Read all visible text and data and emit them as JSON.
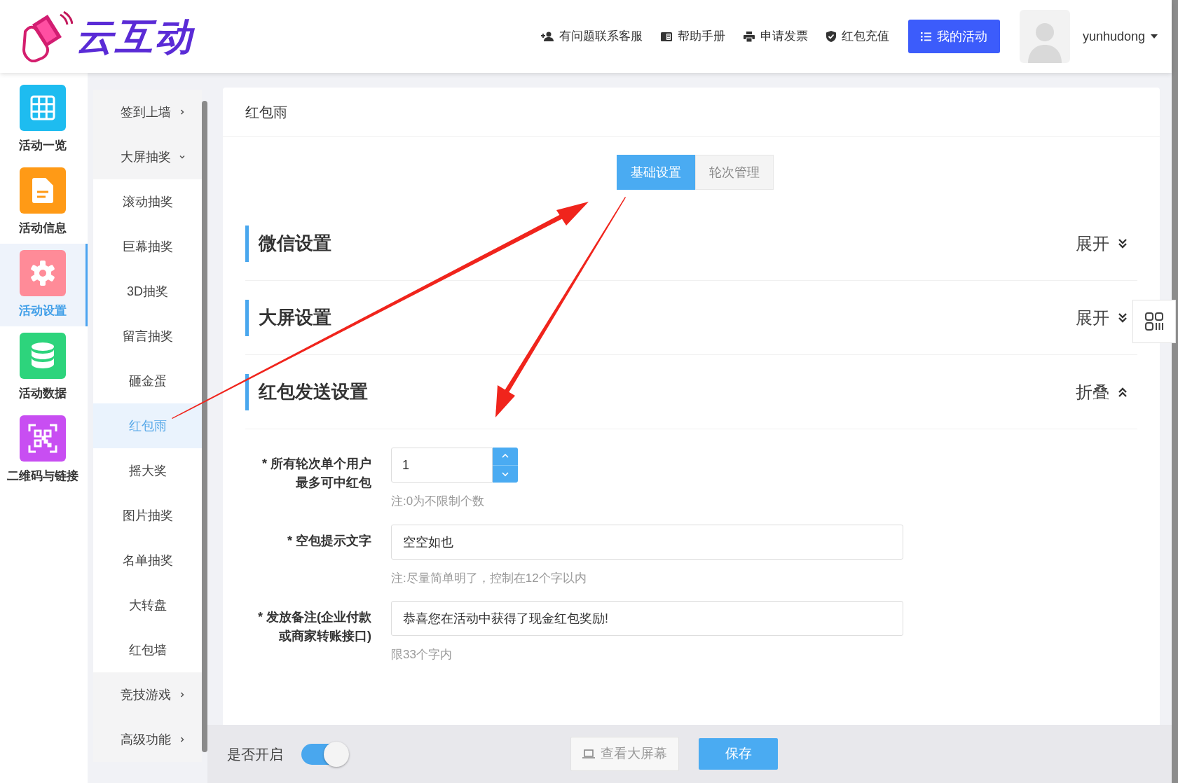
{
  "header": {
    "logo_text": "云互动",
    "links": [
      {
        "label": "有问题联系客服",
        "kind": "contact"
      },
      {
        "label": "帮助手册",
        "kind": "manual"
      },
      {
        "label": "申请发票",
        "kind": "invoice"
      },
      {
        "label": "红包充值",
        "kind": "recharge"
      }
    ],
    "primary_button": "我的活动",
    "username": "yunhudong"
  },
  "sidebar": {
    "items": [
      {
        "label": "活动一览",
        "kind": "overview",
        "color": "#1ebcf0",
        "selected": false
      },
      {
        "label": "活动信息",
        "kind": "info",
        "color": "#ff9a16",
        "selected": false
      },
      {
        "label": "活动设置",
        "kind": "settings",
        "color": "#ff8b98",
        "selected": true
      },
      {
        "label": "活动数据",
        "kind": "data",
        "color": "#2dd47c",
        "selected": false
      },
      {
        "label": "二维码与链接",
        "kind": "links",
        "color": "#c84ef2",
        "selected": false
      }
    ]
  },
  "submenu": {
    "items": [
      {
        "label": "签到上墙",
        "expanded": false
      },
      {
        "label": "大屏抽奖",
        "expanded": true,
        "children": [
          {
            "label": "滚动抽奖",
            "selected": false
          },
          {
            "label": "巨幕抽奖",
            "selected": false
          },
          {
            "label": "3D抽奖",
            "selected": false
          },
          {
            "label": "留言抽奖",
            "selected": false
          },
          {
            "label": "砸金蛋",
            "selected": false
          },
          {
            "label": "红包雨",
            "selected": true
          },
          {
            "label": "摇大奖",
            "selected": false
          },
          {
            "label": "图片抽奖",
            "selected": false
          },
          {
            "label": "名单抽奖",
            "selected": false
          },
          {
            "label": "大转盘",
            "selected": false
          },
          {
            "label": "红包墙",
            "selected": false
          }
        ]
      },
      {
        "label": "竞技游戏",
        "expanded": false
      },
      {
        "label": "高级功能",
        "expanded": false
      }
    ]
  },
  "card": {
    "title": "红包雨",
    "tabs": [
      {
        "label": "基础设置",
        "selected": true
      },
      {
        "label": "轮次管理",
        "selected": false
      }
    ],
    "sections": [
      {
        "title": "微信设置",
        "toggle": "展开",
        "expanded": false
      },
      {
        "title": "大屏设置",
        "toggle": "展开",
        "expanded": false
      },
      {
        "title": "红包发送设置",
        "toggle": "折叠",
        "expanded": true,
        "fields": [
          {
            "kind": "number",
            "label": "* 所有轮次单个用户最多可中红包",
            "value": "1",
            "hint": "注:0为不限制个数"
          },
          {
            "kind": "text",
            "label": "* 空包提示文字",
            "value": "空空如也",
            "hint": "注:尽量简单明了，控制在12个字以内"
          },
          {
            "kind": "text",
            "label": "* 发放备注(企业付款或商家转账接口)",
            "value": "恭喜您在活动中获得了现金红包奖励!",
            "hint": "限33个字内"
          }
        ]
      }
    ]
  },
  "footer": {
    "switch_label": "是否开启",
    "switch_on": true,
    "preview_button": "查看大屏幕",
    "save_button": "保存"
  }
}
